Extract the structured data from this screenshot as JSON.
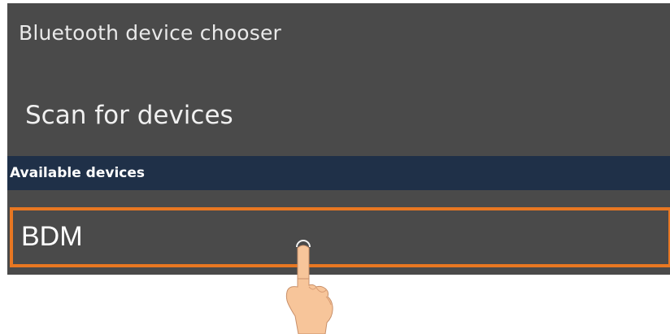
{
  "dialog": {
    "title": "Bluetooth device chooser",
    "scan_action": "Scan for devices",
    "section_header": "Available devices",
    "devices": [
      {
        "label": "BDM",
        "highlighted": true
      }
    ]
  },
  "overlay": {
    "pointer_icon": "tap-hand-icon",
    "highlight_color": "#e87722"
  },
  "colors": {
    "dialog_bg": "#4a4a4a",
    "section_bg": "#1f3048",
    "text": "#f0f0f0"
  }
}
